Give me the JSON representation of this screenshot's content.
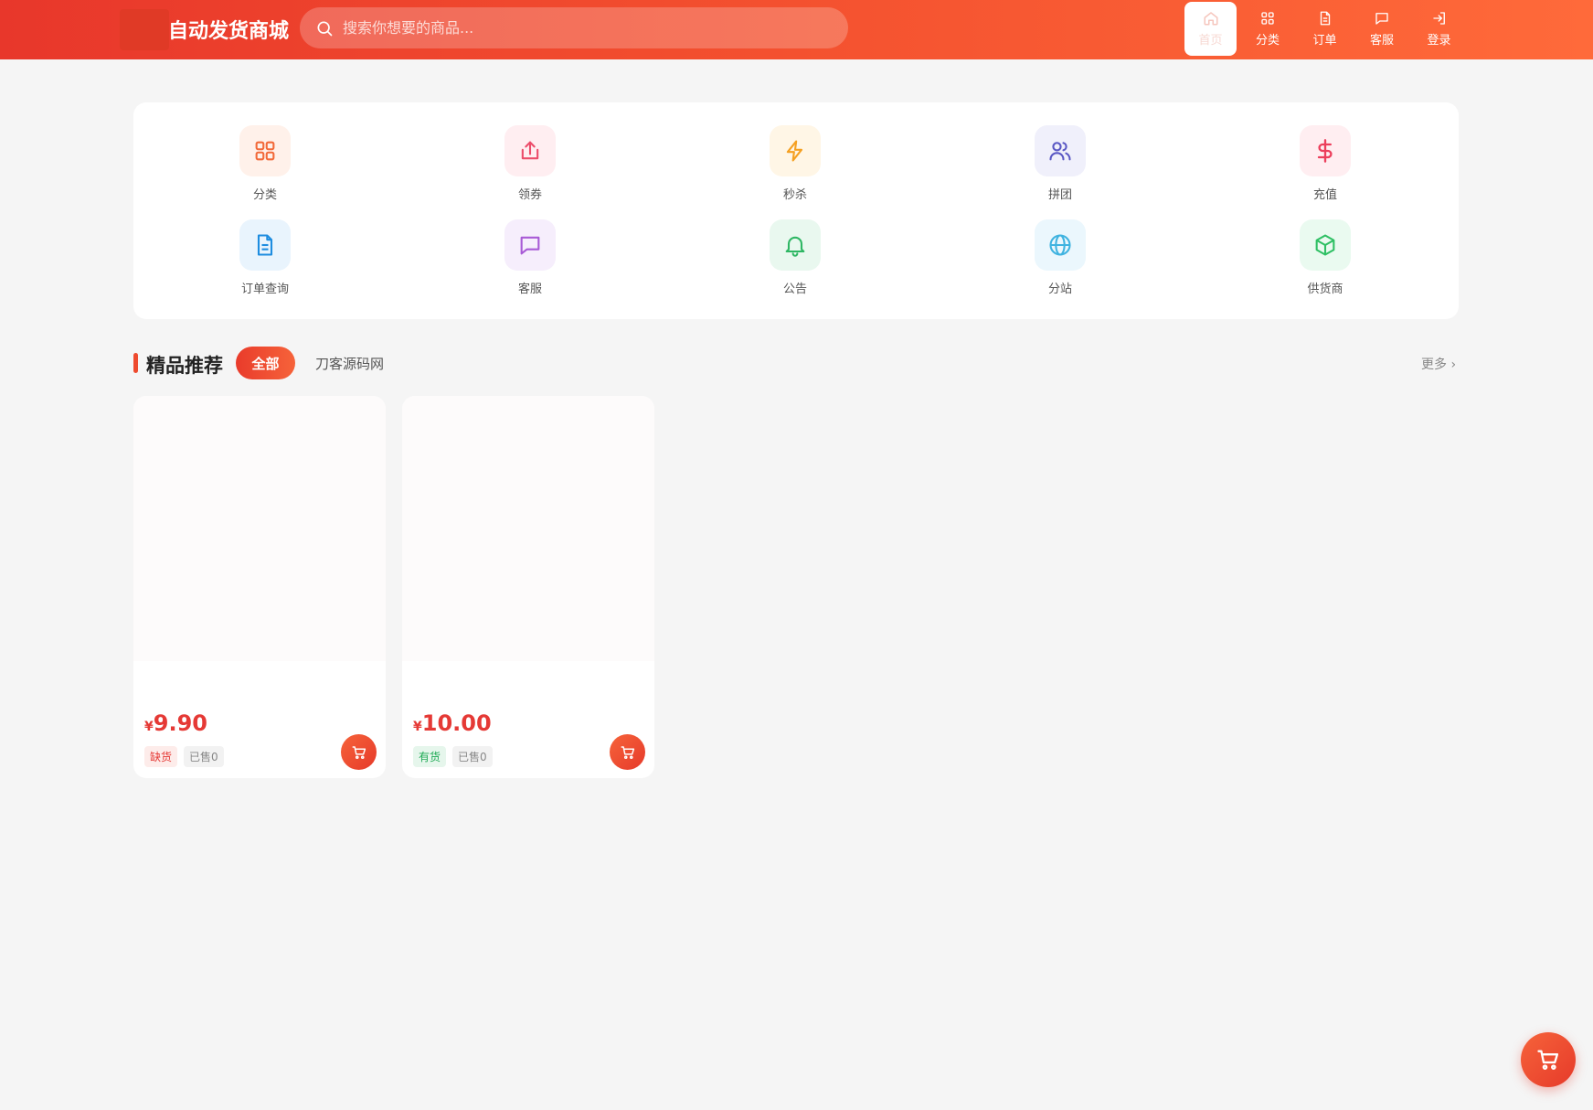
{
  "header": {
    "site_title": "自动发货商城",
    "search_placeholder": "搜索你想要的商品...",
    "nav": [
      {
        "label": "首页",
        "icon": "home-icon",
        "active": true
      },
      {
        "label": "分类",
        "icon": "grid-icon",
        "active": false
      },
      {
        "label": "订单",
        "icon": "document-icon",
        "active": false
      },
      {
        "label": "客服",
        "icon": "message-icon",
        "active": false
      },
      {
        "label": "登录",
        "icon": "login-icon",
        "active": false
      }
    ]
  },
  "categories": [
    {
      "label": "分类",
      "icon": "grid-icon",
      "color": "#f26a3a",
      "bg": "#fff1ea"
    },
    {
      "label": "领券",
      "icon": "share-icon",
      "color": "#ec4c6a",
      "bg": "#ffeef1"
    },
    {
      "label": "秒杀",
      "icon": "lightning-icon",
      "color": "#f5a021",
      "bg": "#fff6e6"
    },
    {
      "label": "拼团",
      "icon": "users-icon",
      "color": "#5a58c4",
      "bg": "#f0f0fb"
    },
    {
      "label": "充值",
      "icon": "dollar-icon",
      "color": "#ec3f5c",
      "bg": "#ffeef1"
    },
    {
      "label": "订单查询",
      "icon": "file-text-icon",
      "color": "#1e8de0",
      "bg": "#e9f4fd"
    },
    {
      "label": "客服",
      "icon": "message-icon",
      "color": "#a85ad6",
      "bg": "#f6eefc"
    },
    {
      "label": "公告",
      "icon": "bell-icon",
      "color": "#2fb764",
      "bg": "#e9f8ef"
    },
    {
      "label": "分站",
      "icon": "globe-icon",
      "color": "#3fb3e0",
      "bg": "#ebf7fd"
    },
    {
      "label": "供货商",
      "icon": "box-icon",
      "color": "#2fc064",
      "bg": "#eafaf0"
    }
  ],
  "section": {
    "title": "精品推荐",
    "tab_all": "全部",
    "tab_other": "刀客源码网",
    "more": "更多 ›"
  },
  "products": [
    {
      "currency": "¥",
      "price": "9.90",
      "stock_tag": "缺货",
      "stock_status": "out",
      "sold": "已售0"
    },
    {
      "currency": "¥",
      "price": "10.00",
      "stock_tag": "有货",
      "stock_status": "in",
      "sold": "已售0"
    }
  ],
  "colors": {
    "accent": "#ee4a2e",
    "price": "#e53935"
  }
}
